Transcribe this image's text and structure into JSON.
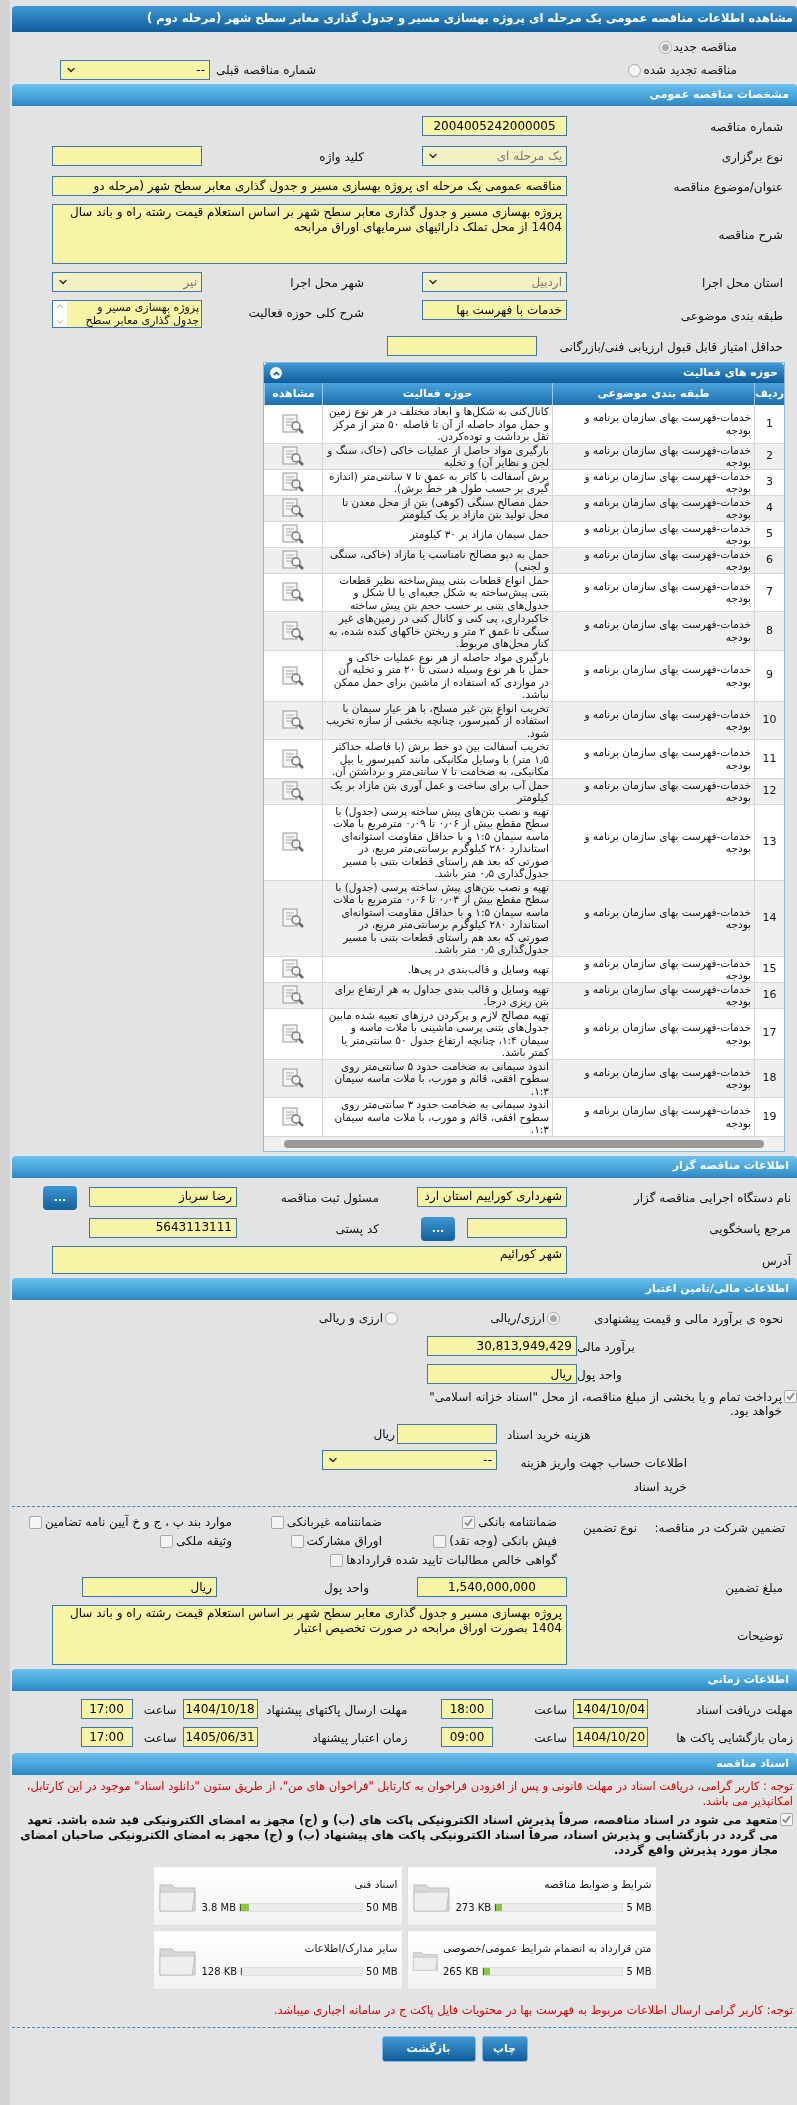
{
  "title": "مشاهده اطلاعات مناقصه عمومی یک مرحله ای پروژه بهسازی مسیر و جدول گذاری معابر سطح شهر (مرحله دوم )",
  "tender_kind": {
    "options": [
      {
        "label": "مناقصه جدید",
        "selected": true
      },
      {
        "label": "مناقصه تجدید شده",
        "selected": false
      }
    ],
    "previous": {
      "label": "شماره مناقصه قبلی",
      "value": "--"
    }
  },
  "general": {
    "title": "مشخصات مناقصه عمومی",
    "tender_number": {
      "label": "شماره مناقصه",
      "value": "2004005242000005"
    },
    "holding_type": {
      "label": "نوع برگزاری",
      "value": "یک مرحله ای",
      "disabled": true
    },
    "keyword": {
      "label": "کلید واژه"
    },
    "subject": {
      "label": "عنوان/موضوع مناقصه",
      "value": "مناقصه عمومی یک مرحله ای پروژه بهسازی مسیر و جدول گذاری معابر سطح شهر (مرحله دو"
    },
    "description": {
      "label": "شرح مناقصه",
      "value": "پروژه بهسازی مسیر و جدول گذاری معابر سطح شهر بر اساس استعلام قیمت رشته راه و باند سال 1404 از محل تملک دارائیهای سرمایهای اوراق مرابحه"
    },
    "province": {
      "label": "استان محل اجرا",
      "value": "اردبیل",
      "disabled": true
    },
    "city": {
      "label": "شهر محل اجرا",
      "value": "نیر",
      "disabled": true
    },
    "category": {
      "label": "طبقه بندی موضوعی",
      "value": "خدمات با فهرست بها"
    },
    "activity_scope": {
      "label": "شرح کلی حوزه فعالیت",
      "value": "پروژه بهسازی مسیر و جدول گذاری معابر سطح"
    },
    "min_score": {
      "label": "حداقل امتیاز قابل قبول ارزیابی فنی/بازرگانی"
    }
  },
  "activities": {
    "title": "حوزه های فعالیت",
    "columns": [
      "ردیف",
      "طبقه بندی موضوعی",
      "حوزه فعالیت",
      "مشاهده"
    ],
    "rows": [
      {
        "index": "1",
        "category": "خدمات-فهرست بهای سازمان برنامه و بودجه",
        "activity": "کانال‌کنی به شکل‌ها و ابعاد مختلف در هر نوع زمین و حمل مواد حاصله از آن تا فاصله ۵۰ متر از مرکز ثقل برداشت و توده‌کردن."
      },
      {
        "index": "2",
        "category": "خدمات-فهرست بهای سازمان برنامه و بودجه",
        "activity": "بارگیری مواد حاصل از عملیات خاکی (خاک، سنگ و لجن و نظایر آن) و تخلیه"
      },
      {
        "index": "3",
        "category": "خدمات-فهرست بهای سازمان برنامه و بودجه",
        "activity": "برش آسفالت با کاتر به عمق تا ۷ سانتی‌متر (اندازه گیری بر حسب طول هر خط برش)."
      },
      {
        "index": "4",
        "category": "خدمات-فهرست بهای سازمان برنامه و بودجه",
        "activity": "حمل مصالح سنگی (کوهی) بتن از محل معدن تا محل تولید بتن مازاد بر یک کیلومتر"
      },
      {
        "index": "5",
        "category": "خدمات-فهرست بهای سازمان برنامه و بودجه",
        "activity": "حمل سیمان مازاد بر ۳۰ کیلومتر"
      },
      {
        "index": "6",
        "category": "خدمات-فهرست بهای سازمان برنامه و بودجه",
        "activity": "حمل به دپو مصالح نامناسب یا مازاد (خاکی، سنگی و لجنی)"
      },
      {
        "index": "7",
        "category": "خدمات-فهرست بهای سازمان برنامه و بودجه",
        "activity": "حمل انواع قطعات بتنی پیش‌ساخته نظیر قطعات بتنی پیش‌ساخته به شکل جعبه‌ای یا U شکل و جدول‌های بتنی بر حسب حجم بتن پیش ساخته"
      },
      {
        "index": "8",
        "category": "خدمات-فهرست بهای سازمان برنامه و بودجه",
        "activity": "خاکبرداری، پی کنی و کانال کنی در زمین‌های غیر سنگی تا عمق ۲ متر و ریختن خاکهای کنده شده، به کنار محل‌های مربوط."
      },
      {
        "index": "9",
        "category": "خدمات-فهرست بهای سازمان برنامه و بودجه",
        "activity": "بارگیری مواد حاصله از هر نوع عملیات خاکی و حمل با هر نوع وسیله دستی تا ۲۰ متر و تخلیه آن در مواردی که استفاده از ماشین برای حمل ممکن نباشد."
      },
      {
        "index": "10",
        "category": "خدمات-فهرست بهای سازمان برنامه و بودجه",
        "activity": "تخریب انواع بتن غیر مسلح، با هر عیار سیمان با استفاده از کمپرسور، چنانچه بخشی از سازه تخریب شود."
      },
      {
        "index": "11",
        "category": "خدمات-فهرست بهای سازمان برنامه و بودجه",
        "activity": "تخریب آسفالت بین دو خط برش (با فاصله حداکثر ۱٫۵ متر) با وسایل مکانیکی مانند کمپرسور یا بیل مکانیکی، به ضخامت تا ۷ سانتی‌متر و برداشتن آن."
      },
      {
        "index": "12",
        "category": "خدمات-فهرست بهای سازمان برنامه و بودجه",
        "activity": "حمل آب برای ساخت و عمل آوری بتن مازاد بر یک کیلومتر"
      },
      {
        "index": "13",
        "category": "خدمات-فهرست بهای سازمان برنامه و بودجه",
        "activity": "تهیه و نصب بتن‌های پیش ساخته پرسی (جدول) با سطح مقطع بیش از ۰٫۰۶ تا ۰٫۰۹ مترمربع با ملات ماسه سیمان ۱:۵ و با حداقل مقاومت استوانه‌ای استاندارد ۲۸۰ کیلوگرم برسانتی‌متر مربع، در صورتی که بعد هم راستای قطعات بتنی با مسیر جدول‌گذاری ۰٫۵ متر باشد."
      },
      {
        "index": "14",
        "category": "خدمات-فهرست بهای سازمان برنامه و بودجه",
        "activity": "تهیه و نصب بتن‌های پیش ساخته پرسی (جدول) با سطح مقطع بیش از ۰٫۰۳ تا ۰٫۰۶ مترمربع با ملات ماسه سیمان ۱:۵ و با حداقل مقاومت استوانه‌ای استاندارد ۲۸۰ کیلوگرم برسانتی‌متر مربع، در صورتی که بعد هم راستای قطعات بتنی با مسیر جدول‌گذاری ۰٫۵ متر باشد."
      },
      {
        "index": "15",
        "category": "خدمات-فهرست بهای سازمان برنامه و بودجه",
        "activity": "تهیه وسایل و قالب‌بندی در پی‌ها."
      },
      {
        "index": "16",
        "category": "خدمات-فهرست بهای سازمان برنامه و بودجه",
        "activity": "تهیه وسایل و قالب بندی جداول به هر ارتفاع برای بتن ریزی درجا."
      },
      {
        "index": "17",
        "category": "خدمات-فهرست بهای سازمان برنامه و بودجه",
        "activity": "تهیه مصالح لازم و پرکردن درزهای تعبیه شده مابین جدول‌های بتنی پرسی ماشینی با ملات ماسه و سیمان ۱:۴، چنانچه ارتفاع جدول ۵۰ سانتی‌متر یا کمتر باشد."
      },
      {
        "index": "18",
        "category": "خدمات-فهرست بهای سازمان برنامه و بودجه",
        "activity": "اندود سیمانی به ضخامت حدود ۵ سانتی‌متر روی سطوح افقی، قائم و مورب، با ملات ماسه سیمان ۱:۳."
      },
      {
        "index": "19",
        "category": "خدمات-فهرست بهای سازمان برنامه و بودجه",
        "activity": "اندود سیمانی به ضخامت حدود ۳ سانتی‌متر روی سطوح افقی، قائم و مورب، با ملات ماسه سیمان ۱:۳."
      }
    ]
  },
  "organizer": {
    "title": "اطلاعات مناقصه گزار",
    "org_name": {
      "label": "نام دستگاه اجرایی مناقصه گزار",
      "value": "شهرداری کوراییم استان ارد"
    },
    "registrar": {
      "label": "مسئول ثبت مناقصه",
      "value": "رضا سرباز",
      "button": "..."
    },
    "reference": {
      "label": "مرجع پاسخگویی",
      "button": "..."
    },
    "postal": {
      "label": "کد پستی",
      "value": "5643113111"
    },
    "address": {
      "label": "آدرس",
      "value": "شهر کورائیم"
    }
  },
  "financial": {
    "title": "اطلاعات مالی/تامین اعتبار",
    "method": {
      "label": "نحوه ی برآورد مالی و قیمت پیشنهادی",
      "options": [
        {
          "label": "ارزی/ریالی",
          "selected": true
        },
        {
          "label": "ارزی و ریالی",
          "selected": false
        }
      ]
    },
    "estimate": {
      "label": "برآورد مالی",
      "value": "30,813,949,429"
    },
    "currency": {
      "label": "واحد پول",
      "value": "ریال"
    },
    "treasury": {
      "label": "پرداخت تمام و یا بخشی از مبلغ مناقصه، از محل \"اسناد خزانه اسلامی\" خواهد بود.",
      "checked": true
    },
    "doc_fee": {
      "label": "هزینه خرید اسناد",
      "unit": "ریال"
    },
    "account": {
      "label": "اطلاعات حساب جهت واریز هزینه خرید اسناد",
      "value": "--"
    }
  },
  "guarantee": {
    "label": "تضمین شرکت در مناقصه:",
    "type_label": "نوع تضمین",
    "options": [
      {
        "label": "ضمانتنامه بانکی",
        "checked": true
      },
      {
        "label": "ضمانتنامه غیربانکی",
        "checked": false
      },
      {
        "label": "موارد بند پ ، ج و خ آیین نامه تضامین",
        "checked": false
      },
      {
        "label": "فیش بانکی (وجه نقد)",
        "checked": false
      },
      {
        "label": "اوراق مشارکت",
        "checked": false
      },
      {
        "label": "وثیقه ملکی",
        "checked": false
      },
      {
        "label": "گواهی خالص مطالبات تایید شده قراردادها",
        "checked": false
      }
    ],
    "amount": {
      "label": "مبلغ تضمین",
      "value": "1,540,000,000"
    },
    "currency": {
      "label": "واحد پول",
      "value": "ریال"
    },
    "notes": {
      "label": "توضیحات",
      "value": "پروژه بهسازی مسیر و جدول گذاری معابر سطح شهر بر اساس استعلام قیمت رشته راه و باند سال 1404 بصورت اوراق مرابحه در صورت تخصیص اعتبار"
    }
  },
  "timing": {
    "title": "اطلاعات زمانی",
    "entries": [
      {
        "label": "مهلت دریافت اسناد",
        "date": "1404/10/04",
        "time_label": "ساعت",
        "time": "18:00"
      },
      {
        "label": "مهلت ارسال پاکتهای پیشنهاد",
        "date": "1404/10/18",
        "time_label": "ساعت",
        "time": "17:00"
      },
      {
        "label": "زمان بازگشایی پاکت ها",
        "date": "1404/10/20",
        "time_label": "ساعت",
        "time": "09:00"
      },
      {
        "label": "زمان اعتبار پیشنهاد",
        "date": "1405/06/31",
        "time_label": "ساعت",
        "time": "17:00"
      }
    ]
  },
  "documents": {
    "title": "اسناد مناقصه",
    "notice": "توجه : کاربر گرامی، دریافت اسناد در مهلت قانونی و پس از افزودن فراخوان به کارتابل \"فراخوان های من\"، از طریق ستون \"دانلود اسناد\" موجود در این کارتابل، امکانپذیر می باشد.",
    "commitment": {
      "text": "متعهد می شود در اسناد مناقصه، صرفاً پذیرش اسناد الکترونیکی پاکت های (ب) و (ج) مجهز به امضای الکترونیکی قید شده باشد. تعهد می گردد در بازگشایی و پذیرش اسناد، صرفاً اسناد الکترونیکی پاکت های پیشنهاد (ب) و (ج) مجهز به امضای الکترونیکی صاحبان امضای مجاز مورد پذیرش واقع گردد.",
      "checked": true
    },
    "files": [
      {
        "name": "شرایط و ضوابط مناقصه",
        "max": "5 MB",
        "size": "273 KB",
        "level": 0.053
      },
      {
        "name": "اسناد فنی",
        "max": "50 MB",
        "size": "3.8 MB",
        "level": 0.076
      },
      {
        "name": "متن قرارداد به انضمام شرایط عمومی/خصوصی",
        "max": "5 MB",
        "size": "265 KB",
        "level": 0.052
      },
      {
        "name": "سایر مدارک/اطلاعات",
        "max": "50 MB",
        "size": "128 KB",
        "level": 0.0025
      }
    ],
    "footer_note": "توجه: کاربر گرامی ارسال اطلاعات مربوط به فهرست بها در محتویات فایل پاکت ج در سامانه اجباری میباشد."
  },
  "buttons": [
    "چاپ",
    "بازگشت"
  ]
}
